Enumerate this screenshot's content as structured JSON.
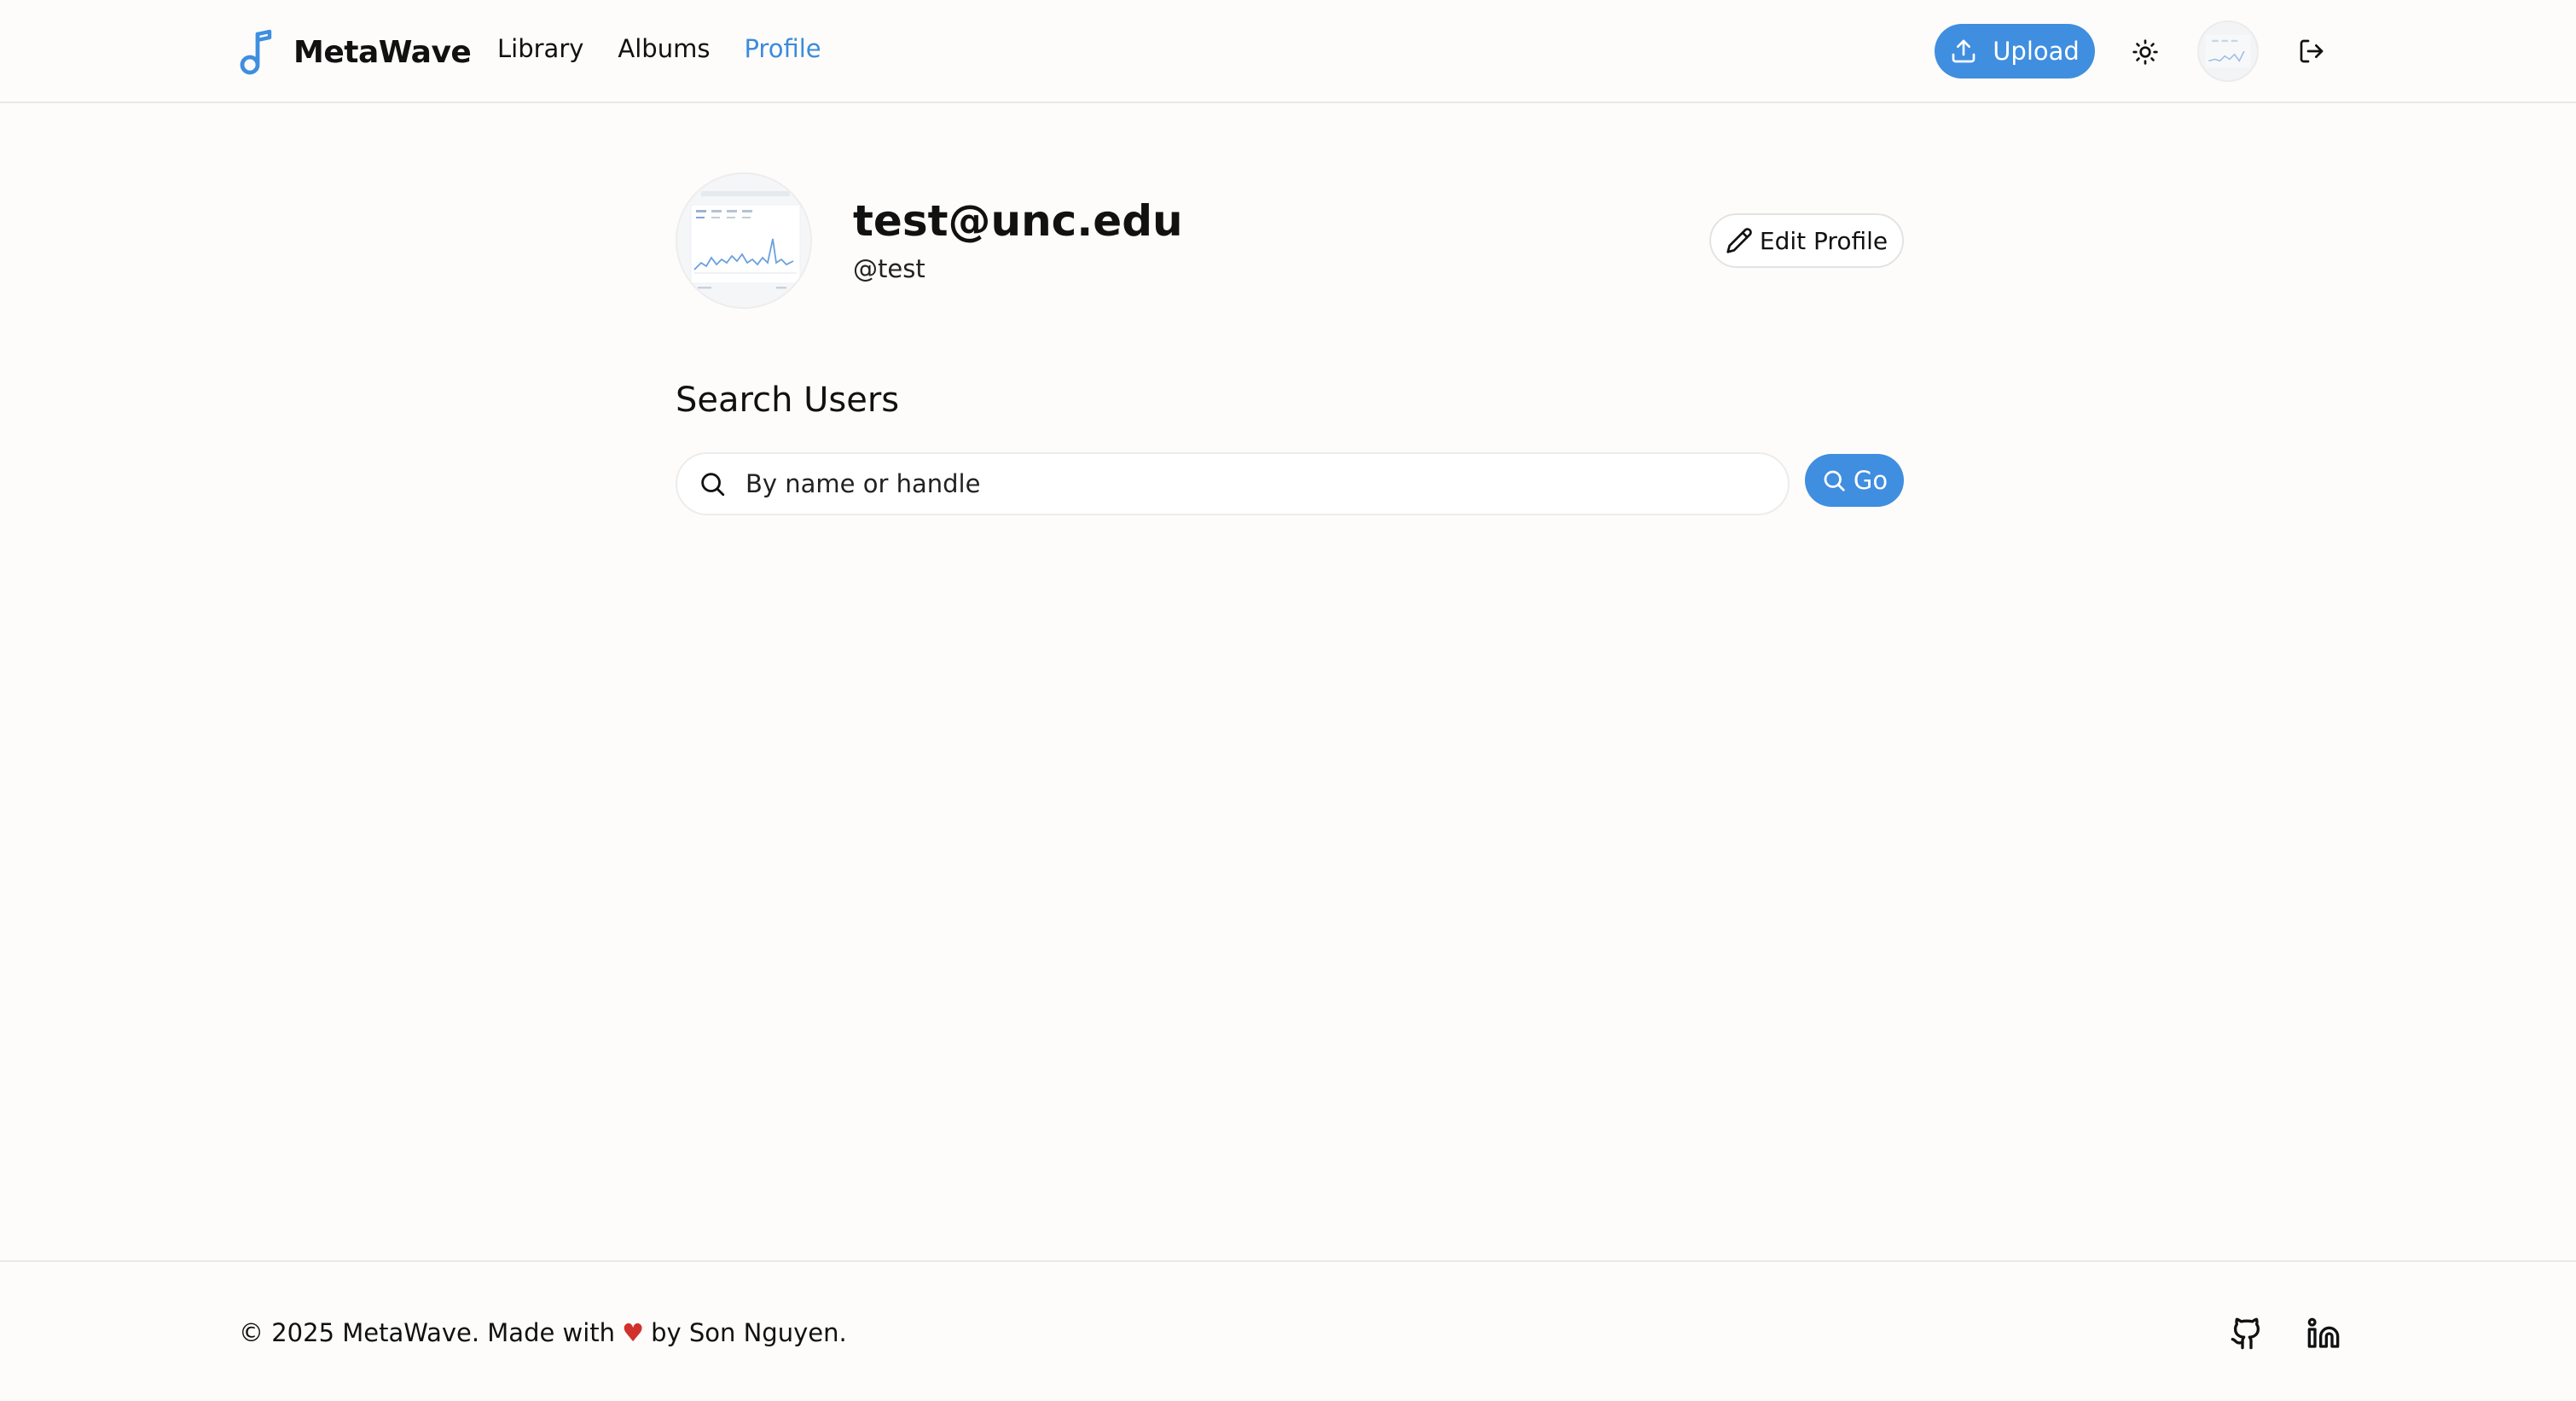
{
  "brand": {
    "name": "MetaWave",
    "accent_color": "#3f8ee0",
    "logo_icon": "music-note-icon"
  },
  "nav": {
    "items": [
      {
        "label": "Library",
        "active": false
      },
      {
        "label": "Albums",
        "active": false
      },
      {
        "label": "Profile",
        "active": true
      }
    ]
  },
  "header": {
    "upload_label": "Upload",
    "upload_icon": "upload-icon",
    "theme_icon": "sun-icon",
    "logout_icon": "logout-icon"
  },
  "profile": {
    "name": "test@unc.edu",
    "handle": "@test",
    "edit_label": "Edit Profile"
  },
  "search": {
    "title": "Search Users",
    "placeholder": "By name or handle",
    "value": "",
    "go_label": "Go"
  },
  "footer": {
    "copyright_prefix": "© 2025 MetaWave. Made with",
    "heart": "♥",
    "copyright_suffix": "by Son Nguyen.",
    "heart_color": "#d0312d",
    "social_icons": [
      "github-icon",
      "linkedin-icon"
    ]
  }
}
